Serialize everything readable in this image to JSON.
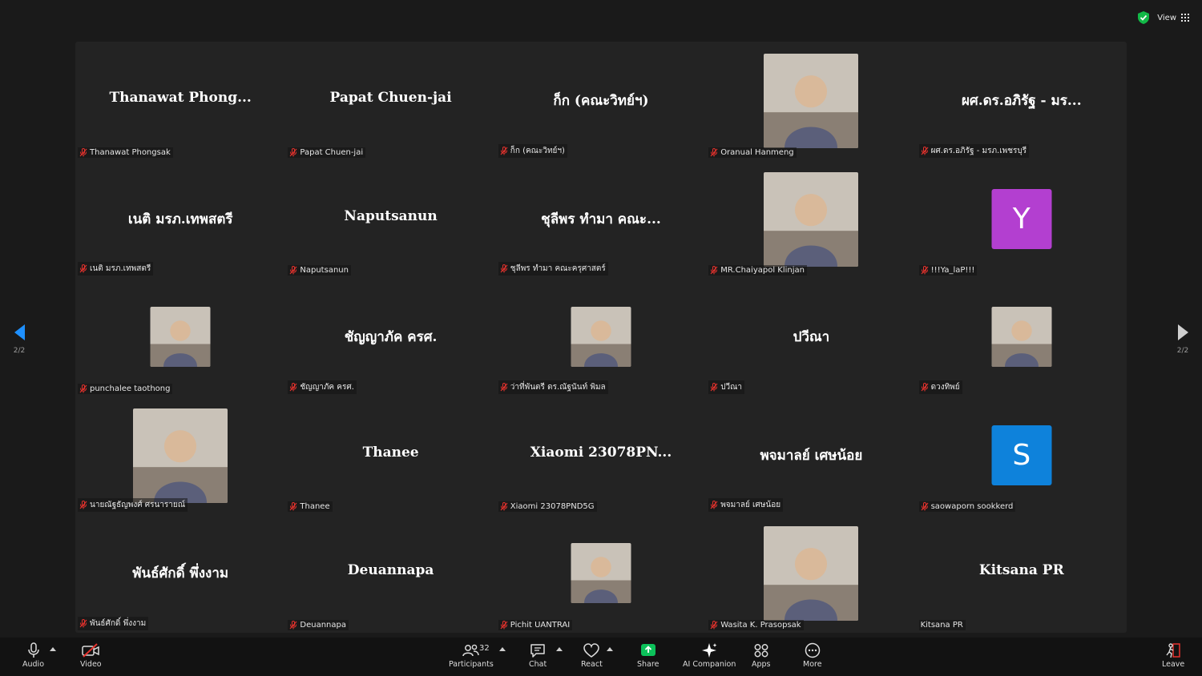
{
  "top": {
    "view_label": "View"
  },
  "pager": {
    "left_page": "2/2",
    "right_page": "2/2"
  },
  "tiles": [
    {
      "title": "Thanawat  Phong...",
      "name": "Thanawat Phongsak",
      "muted": true
    },
    {
      "title": "Papat Chuen-jai",
      "name": "Papat Chuen-jai",
      "muted": true
    },
    {
      "title": "ก็ก (คณะวิทย์ฯ)",
      "name": "ก็ก (คณะวิทย์ฯ)",
      "muted": true
    },
    {
      "photo": "large",
      "name": "Oranual Hanmeng",
      "muted": true
    },
    {
      "title": "ผศ.ดร.อภิรัฐ - มร...",
      "name": "ผศ.ดร.อภิรัฐ - มรภ.เพชรบุรี",
      "muted": true
    },
    {
      "title": "เนติ  มรภ.เทพสตรี",
      "name": "เนติ  มรภ.เทพสตรี",
      "muted": true
    },
    {
      "title": "Naputsanun",
      "name": "Naputsanun",
      "muted": true
    },
    {
      "title": "ชุลีพร ทำมา คณะ...",
      "name": "ชุลีพร ทำมา คณะครุศาสตร์",
      "muted": true
    },
    {
      "photo": "large",
      "name": "MR.Chaiyapol Klinjan",
      "muted": true
    },
    {
      "letter": "Y",
      "letter_color": "#b33fd0",
      "name": "!!!Ya_laP!!!",
      "muted": true
    },
    {
      "photo": "small",
      "name": "punchalee taothong",
      "muted": true
    },
    {
      "title": "ชัญญาภัค ครศ.",
      "name": "ชัญญาภัค ครศ.",
      "muted": true
    },
    {
      "photo": "small",
      "name": "ว่าที่พันตรี ดร.ณัฐนันท์ พิมล",
      "muted": true
    },
    {
      "title": "ปวีณา",
      "name": "ปวีณา",
      "muted": true
    },
    {
      "photo": "small",
      "name": "ดวงทิพย์",
      "muted": true
    },
    {
      "photo": "large",
      "name": "นายณัฐธัญพงศ์ ศรนารายณ์",
      "muted": true
    },
    {
      "title": "Thanee",
      "name": "Thanee",
      "muted": true
    },
    {
      "title": "Xiaomi  23078PN...",
      "name": "Xiaomi 23078PND5G",
      "muted": true
    },
    {
      "title": "พจมาลย์   เศษน้อย",
      "name": "พจมาลย์   เศษน้อย",
      "muted": true
    },
    {
      "letter": "S",
      "letter_color": "#0e82db",
      "name": "saowaporn sookkerd",
      "muted": true
    },
    {
      "title": "พันธ์ศักดิ์ พึ่งงาม",
      "name": "พันธ์ศักดิ์ พึ่งงาม",
      "muted": true
    },
    {
      "title": "Deuannapa",
      "name": "Deuannapa",
      "muted": true
    },
    {
      "photo": "small",
      "name": "Pichit UANTRAI",
      "muted": true
    },
    {
      "photo": "large",
      "name": "Wasita K. Prasopsak",
      "muted": true
    },
    {
      "title": "Kitsana PR",
      "name": "Kitsana PR",
      "muted": false
    }
  ],
  "toolbar": {
    "audio": "Audio",
    "video": "Video",
    "participants": "Participants",
    "participants_count": "32",
    "chat": "Chat",
    "react": "React",
    "share": "Share",
    "ai_companion": "AI Companion",
    "apps": "Apps",
    "more": "More",
    "leave": "Leave"
  },
  "colors": {
    "share_green": "#0cc15a",
    "muted_red": "#e5322d",
    "pager_blue": "#1e90ff"
  }
}
